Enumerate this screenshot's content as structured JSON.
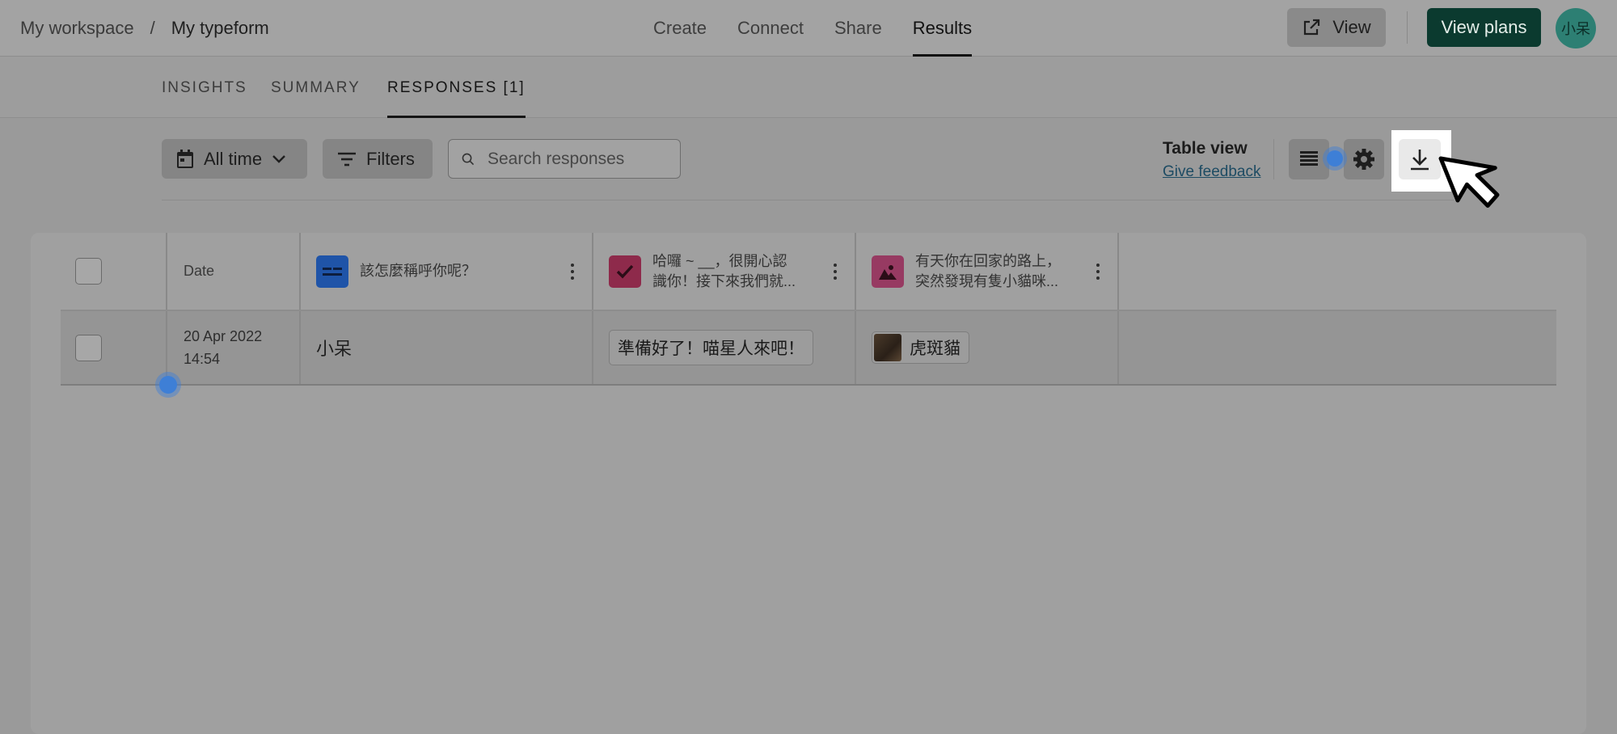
{
  "breadcrumb": {
    "workspace": "My workspace",
    "separator": "/",
    "form": "My typeform"
  },
  "nav": {
    "create": "Create",
    "connect": "Connect",
    "share": "Share",
    "results": "Results"
  },
  "header": {
    "view_label": "View",
    "plans_label": "View plans",
    "avatar_text": "小呆"
  },
  "subtabs": {
    "insights": "INSIGHTS",
    "summary": "SUMMARY",
    "responses": "RESPONSES [1]"
  },
  "toolbar": {
    "time_filter": "All time",
    "filters": "Filters",
    "search_placeholder": "Search responses",
    "table_view": "Table view",
    "feedback": "Give feedback"
  },
  "table": {
    "columns": [
      {
        "label": "Date"
      },
      {
        "label": "該怎麼稱呼你呢？",
        "icon": "short-text-icon",
        "icon_color": "#1f54a8"
      },
      {
        "label_line1": "哈囉 ~ __，很開心認",
        "label_line2": "識你！接下來我們就...",
        "icon": "checkbox-icon",
        "icon_color": "#8e2a4b"
      },
      {
        "label_line1": "有天你在回家的路上，",
        "label_line2": "突然發現有隻小貓咪...",
        "icon": "picture-choice-icon",
        "icon_color": "#973a62"
      }
    ],
    "rows": [
      {
        "date": "20 Apr 2022",
        "time": "14:54",
        "name": "小呆",
        "choice": "準備好了！喵星人來吧！",
        "picture_choice": "虎斑貓"
      }
    ]
  },
  "colors": {
    "accent_dark_green": "#0b3a2f",
    "avatar_teal": "#2d7f73",
    "highlight_dot": "#3e7fd6"
  }
}
